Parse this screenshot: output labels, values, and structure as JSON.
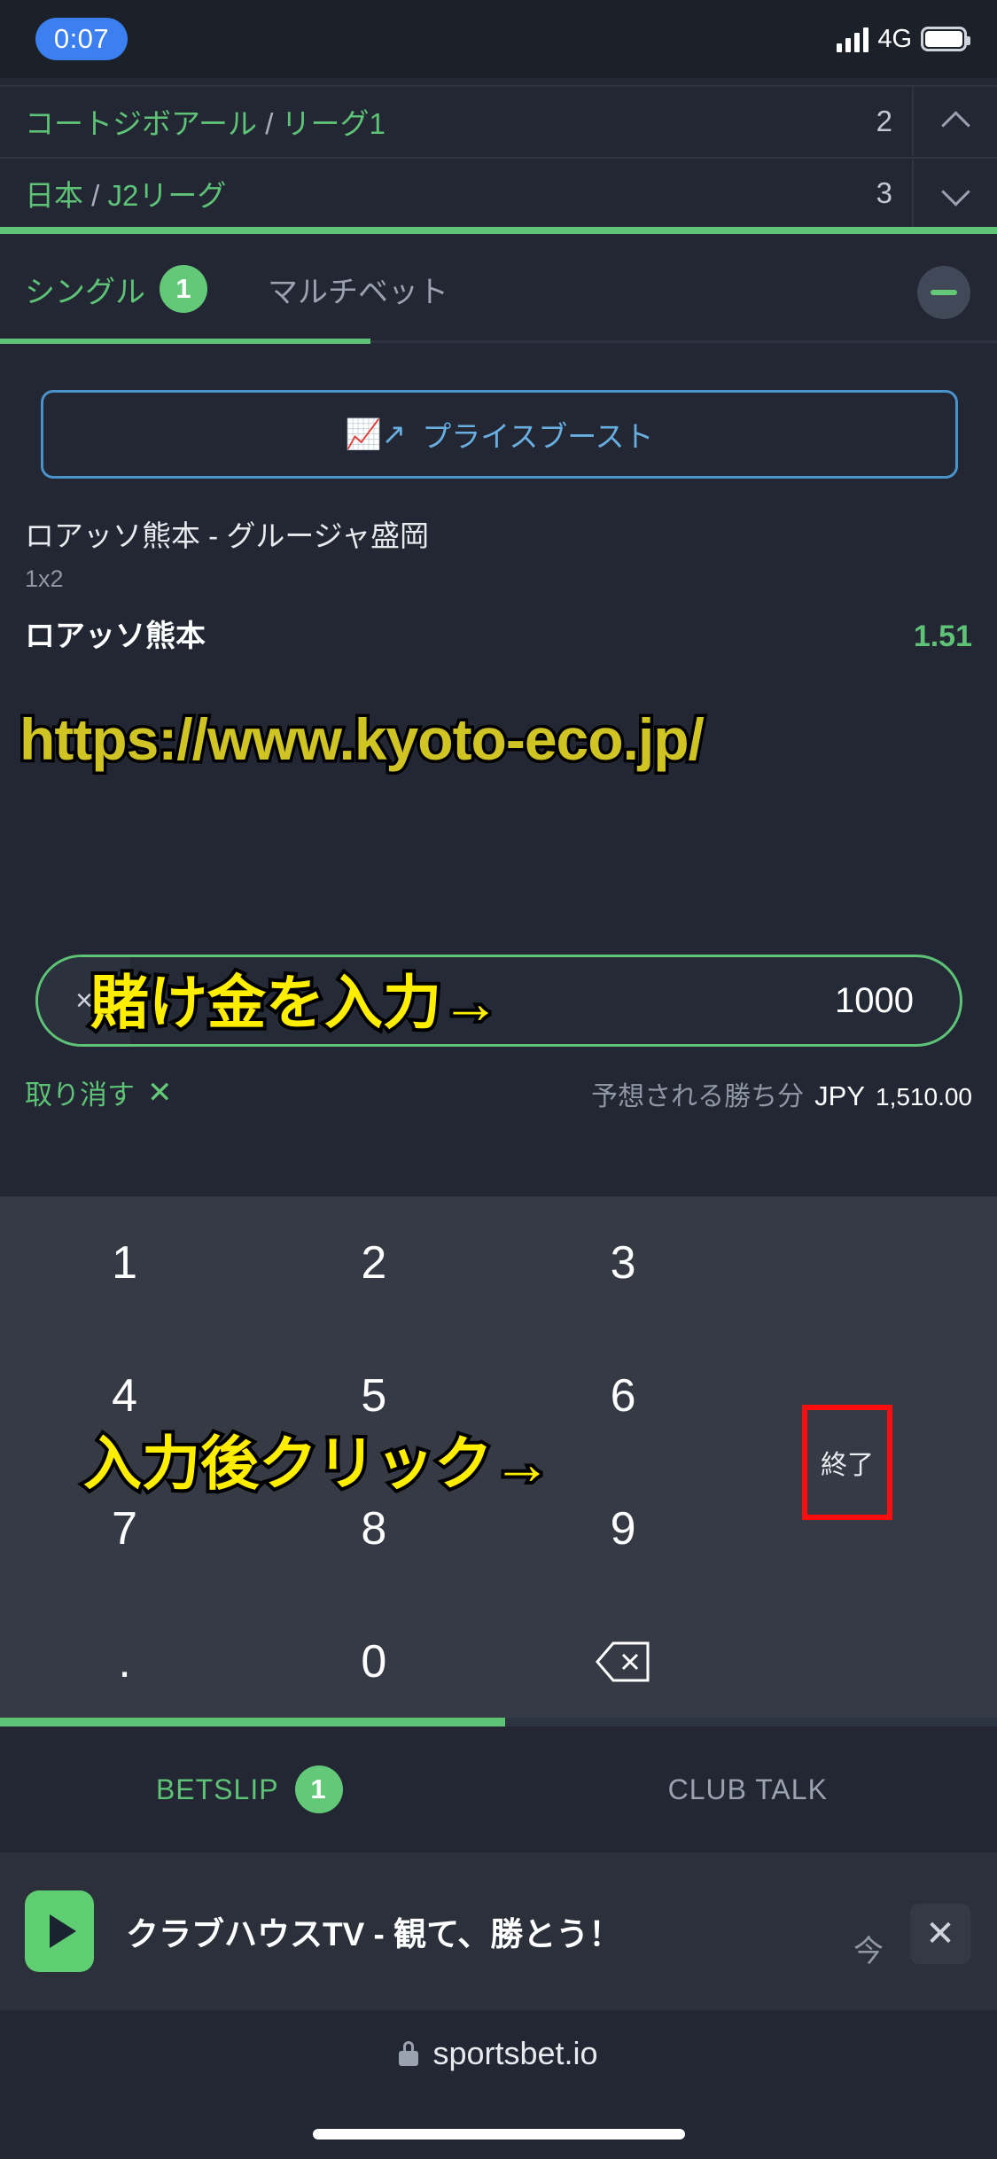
{
  "status_bar": {
    "time": "0:07",
    "network": "4G",
    "signal_icon": "signal-bars-icon",
    "battery_icon": "battery-icon"
  },
  "leagues": [
    {
      "country": "コートジボアール",
      "separator": "/",
      "league": "リーグ1",
      "count": "2",
      "chevron": "chevron-up-icon"
    },
    {
      "country": "日本",
      "separator": "/",
      "league": "J2リーグ",
      "count": "3",
      "chevron": "chevron-down-icon"
    }
  ],
  "tabs": {
    "single": {
      "label": "シングル",
      "badge": "1"
    },
    "multi": {
      "label": "マルチベット"
    },
    "collapse_icon": "minus-icon"
  },
  "betslip": {
    "price_boost": {
      "label": "プライスブースト",
      "icon": "trending-up-icon"
    },
    "event": "ロアッソ熊本 - グルージャ盛岡",
    "market": "1x2",
    "selection": "ロアッソ熊本",
    "odds": "1.51",
    "stake": {
      "multiplier_icon": "×",
      "value": "1000",
      "placeholder": "賭け金"
    },
    "cancel": {
      "label": "取り消す",
      "icon": "✕"
    },
    "payout": {
      "label": "予想される勝ち分",
      "currency": "JPY",
      "amount": "1,510.00"
    }
  },
  "keypad": {
    "rows": [
      [
        "1",
        "2",
        "3"
      ],
      [
        "4",
        "5",
        "6"
      ],
      [
        "7",
        "8",
        "9"
      ],
      [
        ".",
        "0",
        "backspace-icon"
      ]
    ],
    "done_label": "終了"
  },
  "bottom_nav": {
    "betslip": {
      "label": "BETSLIP",
      "badge": "1"
    },
    "club_talk": {
      "label": "CLUB TALK"
    }
  },
  "ad": {
    "play_icon": "play-icon",
    "title": "クラブハウスTV - 観て、勝とう！",
    "now": "今",
    "close_icon": "✕"
  },
  "browser": {
    "lock_icon": "lock-icon",
    "url": "sportsbet.io"
  },
  "annotations": {
    "watermark_url": "https://www.kyoto-eco.jp/",
    "stake_hint": "賭け金を入力→",
    "click_hint": "入力後クリック→"
  },
  "colors": {
    "accent_green": "#5ec277",
    "bg_dark": "#222733",
    "keypad_bg": "#353a45",
    "annotation_yellow": "#ffee00",
    "watermark_yellow": "#cfc424",
    "highlight_red": "#fd0d0d",
    "boost_blue": "#4a93cc",
    "time_pill_blue": "#3b7ff0"
  }
}
